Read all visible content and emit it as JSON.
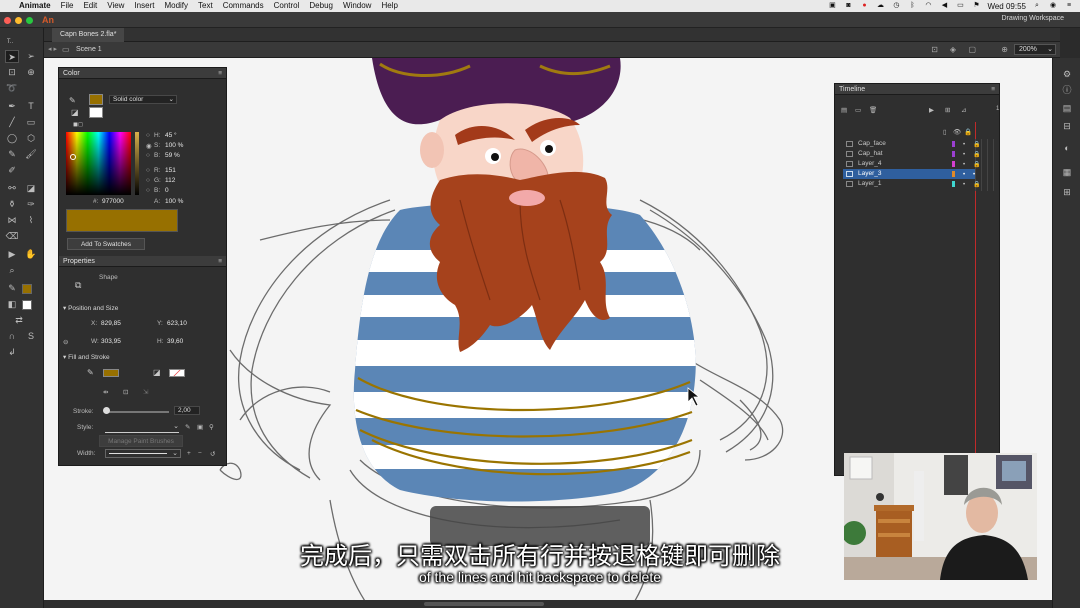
{
  "menubar": {
    "app_name": "Animate",
    "items": [
      "File",
      "Edit",
      "View",
      "Insert",
      "Modify",
      "Text",
      "Commands",
      "Control",
      "Debug",
      "Window",
      "Help"
    ],
    "clock": "Wed 09:55"
  },
  "titlebar": {
    "app_icon": "An",
    "workspace": "Drawing Workspace"
  },
  "document": {
    "tab": "Capn Bones 2.fla*",
    "scene": "Scene 1",
    "zoom": "200%"
  },
  "color_panel": {
    "title": "Color",
    "fill_type": "Solid color",
    "h_label": "H:",
    "h_value": "45 °",
    "s_label": "S:",
    "s_value": "100 %",
    "b_label": "B:",
    "b_value": "59 %",
    "r_label": "R:",
    "r_value": "151",
    "g_label": "G:",
    "g_value": "112",
    "bl_label": "B:",
    "bl_value": "0",
    "hex_label": "#:",
    "hex_value": "977000",
    "a_label": "A:",
    "a_value": "100 %",
    "add_swatch": "Add To Swatches",
    "swatch_color": "#977000"
  },
  "properties_panel": {
    "title": "Properties",
    "shape_label": "Shape",
    "pos_section": "Position and Size",
    "x_label": "X:",
    "x_value": "829,85",
    "y_label": "Y:",
    "y_value": "623,10",
    "w_label": "W:",
    "w_value": "303,95",
    "h_label": "H:",
    "h_value": "39,60",
    "fill_section": "Fill and Stroke",
    "stroke_label": "Stroke:",
    "stroke_value": "2,00",
    "style_label": "Style:",
    "brush_btn": "Manage Paint Brushes",
    "width_label": "Width:"
  },
  "timeline": {
    "title": "Timeline",
    "layers": [
      {
        "name": "Cap_face",
        "color": "#9b3fd1",
        "selected": false
      },
      {
        "name": "Cap_hat",
        "color": "#9b3fd1",
        "selected": false
      },
      {
        "name": "Layer_4",
        "color": "#d23fd0",
        "selected": false
      },
      {
        "name": "Layer_3",
        "color": "#e08a2a",
        "selected": true
      },
      {
        "name": "Layer_1",
        "color": "#3fd6d0",
        "selected": false
      }
    ],
    "frame_number": "1"
  },
  "subtitles": {
    "zh": "完成后，只需双击所有行并按退格键即可删除",
    "en": "of the lines and hit backspace to delete"
  }
}
